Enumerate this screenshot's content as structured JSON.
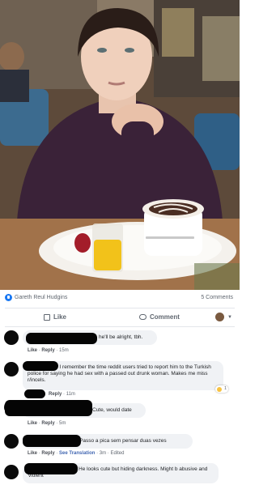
{
  "post": {
    "reacted_by": "Gareth Reul Hudgins",
    "comments_count": "5 Comments"
  },
  "actions": {
    "like": "Like",
    "comment": "Comment"
  },
  "comments": [
    {
      "text": "he'll be alright, tbh.",
      "like": "Like",
      "reply": "Reply",
      "time": "15m"
    },
    {
      "text": "e I remember the time reddit users tried to report him to the Turkish police for saying he had sex with a passed out drunk woman. Makes me miss r/incels.",
      "reply": "Reply",
      "time": "11m",
      "reaction_count": "1"
    },
    {
      "text": "Cute, would date",
      "like": "Like",
      "reply": "Reply",
      "time": "5m"
    },
    {
      "text": "Passo a pica sem pensar duas vezes",
      "like": "Like",
      "reply": "Reply",
      "translate": "See Translation",
      "time": "3m",
      "edited": "Edited"
    },
    {
      "text": "He looks cute but hiding darkness. Might b abusive and violent"
    }
  ],
  "colors": {
    "link_blue": "#4267b2",
    "like_badge": "#1877f2",
    "bubble_bg": "#f0f2f5",
    "redaction": "#050505"
  }
}
